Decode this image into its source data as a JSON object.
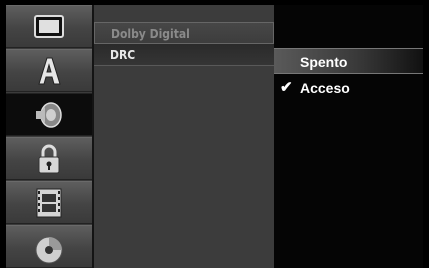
{
  "sidebar": {
    "items": [
      {
        "icon": "tv-screen-icon"
      },
      {
        "icon": "language-a-icon"
      },
      {
        "icon": "audio-speaker-icon"
      },
      {
        "icon": "padlock-icon"
      },
      {
        "icon": "film-icon"
      },
      {
        "icon": "disc-icon"
      }
    ],
    "active_index": 2
  },
  "menu": {
    "items": [
      {
        "label": "Dolby Digital"
      },
      {
        "label": "DRC"
      }
    ],
    "selected_index": 1
  },
  "options": {
    "items": [
      {
        "label": "Spento",
        "highlighted": true,
        "checked": false
      },
      {
        "label": "Acceso",
        "highlighted": false,
        "checked": true
      }
    ],
    "check_glyph": "✔"
  }
}
